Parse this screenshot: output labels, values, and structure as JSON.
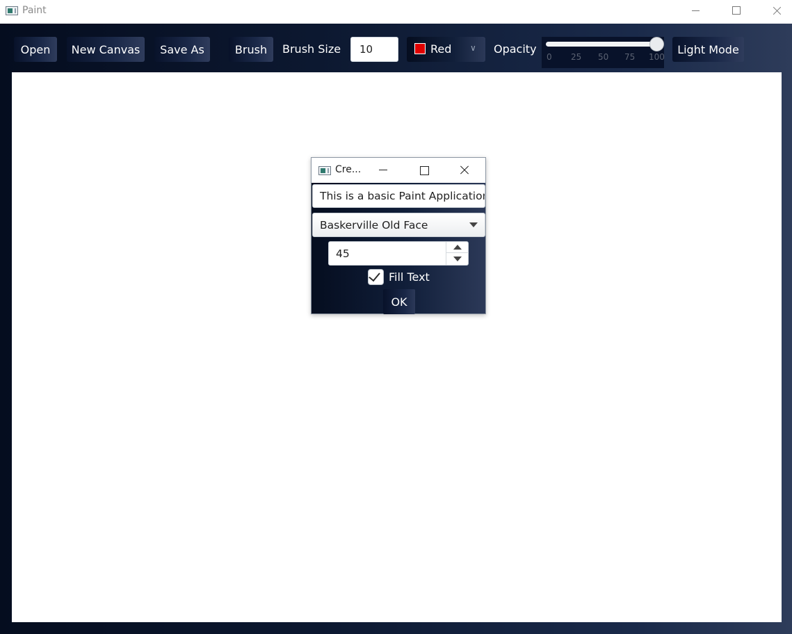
{
  "window": {
    "title": "Paint",
    "icon": "paint-app-icon"
  },
  "toolbar": {
    "open_label": "Open",
    "new_canvas_label": "New Canvas",
    "save_as_label": "Save As",
    "brush_label": "Brush",
    "brush_size_label": "Brush Size",
    "brush_size_value": "10",
    "color": {
      "selected": "Red",
      "swatch_color": "#e00000"
    },
    "opacity_label": "Opacity",
    "opacity": {
      "value": 100,
      "min": 0,
      "max": 100,
      "ticks": [
        "0",
        "25",
        "50",
        "75",
        "100"
      ]
    },
    "theme_label": "Light Mode"
  },
  "dialog": {
    "title": "Cre...",
    "text_value": "This is a basic Paint Application",
    "font_value": "Baskerville Old Face",
    "size_value": "45",
    "fill_text_label": "Fill Text",
    "fill_text_checked": true,
    "ok_label": "OK"
  },
  "colors": {
    "toolbar_bg_start": "#050d1f",
    "toolbar_bg_end": "#2e3c5a",
    "canvas_bg": "#ffffff"
  }
}
